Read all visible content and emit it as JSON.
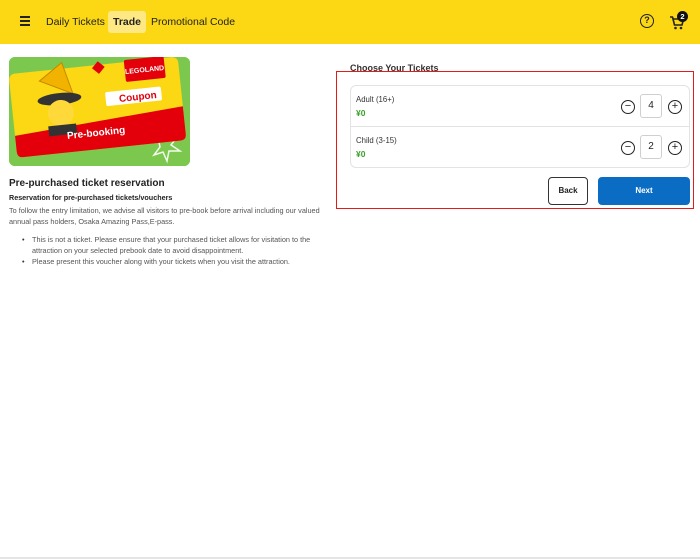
{
  "header": {
    "nav": {
      "daily_tickets": "Daily Tickets",
      "trade": "Trade",
      "promotional_code": "Promotional Code"
    },
    "help_icon": "question-circle-icon",
    "help_glyph": "?",
    "cart_icon": "shopping-cart-icon",
    "cart_count": "2",
    "background_color": "#fcd714"
  },
  "promo_image": {
    "brand": "LEGOLAND",
    "coupon_label": "Coupon",
    "banner_label": "Pre-booking"
  },
  "info": {
    "title": "Pre-purchased ticket reservation",
    "subtitle": "Reservation for pre-purchased tickets/vouchers",
    "description": "To follow the entry limitation, we advise all visitors to pre-book before arrival including our valued annual pass holders, Osaka Amazing Pass,E-pass.",
    "bullets": [
      "This is not a ticket. Please ensure that your purchased ticket allows for visitation to the attraction on your selected prebook date to avoid disappointment.",
      "Please present this voucher along with your tickets when you visit the attraction."
    ]
  },
  "tickets": {
    "title": "Choose Your Tickets",
    "items": [
      {
        "name": "Adult (16+)",
        "price": "¥0",
        "quantity": "4"
      },
      {
        "name": "Child (3-15)",
        "price": "¥0",
        "quantity": "2"
      }
    ],
    "minus_glyph": "−",
    "plus_glyph": "+",
    "price_color": "#3aa02a"
  },
  "actions": {
    "back_label": "Back",
    "next_label": "Next",
    "next_color": "#0b6cc4"
  },
  "highlight_color": "#e21b1b"
}
